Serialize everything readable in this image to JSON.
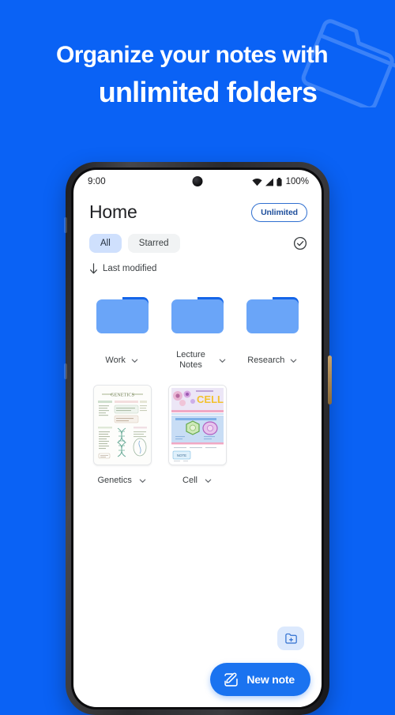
{
  "promo": {
    "headline_line1": "Organize your notes with",
    "headline_line2": "unlimited folders",
    "background_color": "#0a62f5",
    "deco_icon": "tilted-folder-outline"
  },
  "phone": {
    "statusbar": {
      "time": "9:00",
      "battery_percent": "100%",
      "icons": [
        "wifi-icon",
        "cellular-signal-icon",
        "battery-icon"
      ]
    },
    "side_buttons": [
      "volume-up-button",
      "volume-down-button",
      "power-button"
    ]
  },
  "app": {
    "header": {
      "title": "Home",
      "badge_label": "Unlimited",
      "badge_border_color": "#2f6fd0",
      "badge_text_color": "#1f4f9c"
    },
    "filters": {
      "chips": [
        {
          "label": "All",
          "selected": true
        },
        {
          "label": "Starred",
          "selected": false
        }
      ],
      "selected_chip_color": "#cfe0fd",
      "select_mode_icon": "check-circle-icon"
    },
    "sort": {
      "direction_icon": "arrow-down-icon",
      "label": "Last modified"
    },
    "folders": [
      {
        "name": "Work",
        "icon": "folder-icon",
        "menu_icon": "chevron-down-icon"
      },
      {
        "name": "Lecture Notes",
        "icon": "folder-icon",
        "menu_icon": "chevron-down-icon"
      },
      {
        "name": "Research",
        "icon": "folder-icon",
        "menu_icon": "chevron-down-icon"
      }
    ],
    "folder_colors": {
      "body": "#6aa5f8",
      "tab": "#1565e8"
    },
    "notes": [
      {
        "name": "Genetics",
        "thumbnail_title": "GENETICS",
        "menu_icon": "chevron-down-icon"
      },
      {
        "name": "Cell",
        "thumbnail_title": "CELL",
        "menu_icon": "chevron-down-icon"
      }
    ],
    "actions": {
      "new_folder_icon": "new-folder-icon",
      "new_note_label": "New note",
      "new_note_icon": "edit-pencil-icon",
      "fab_color": "#1a73f0"
    }
  }
}
